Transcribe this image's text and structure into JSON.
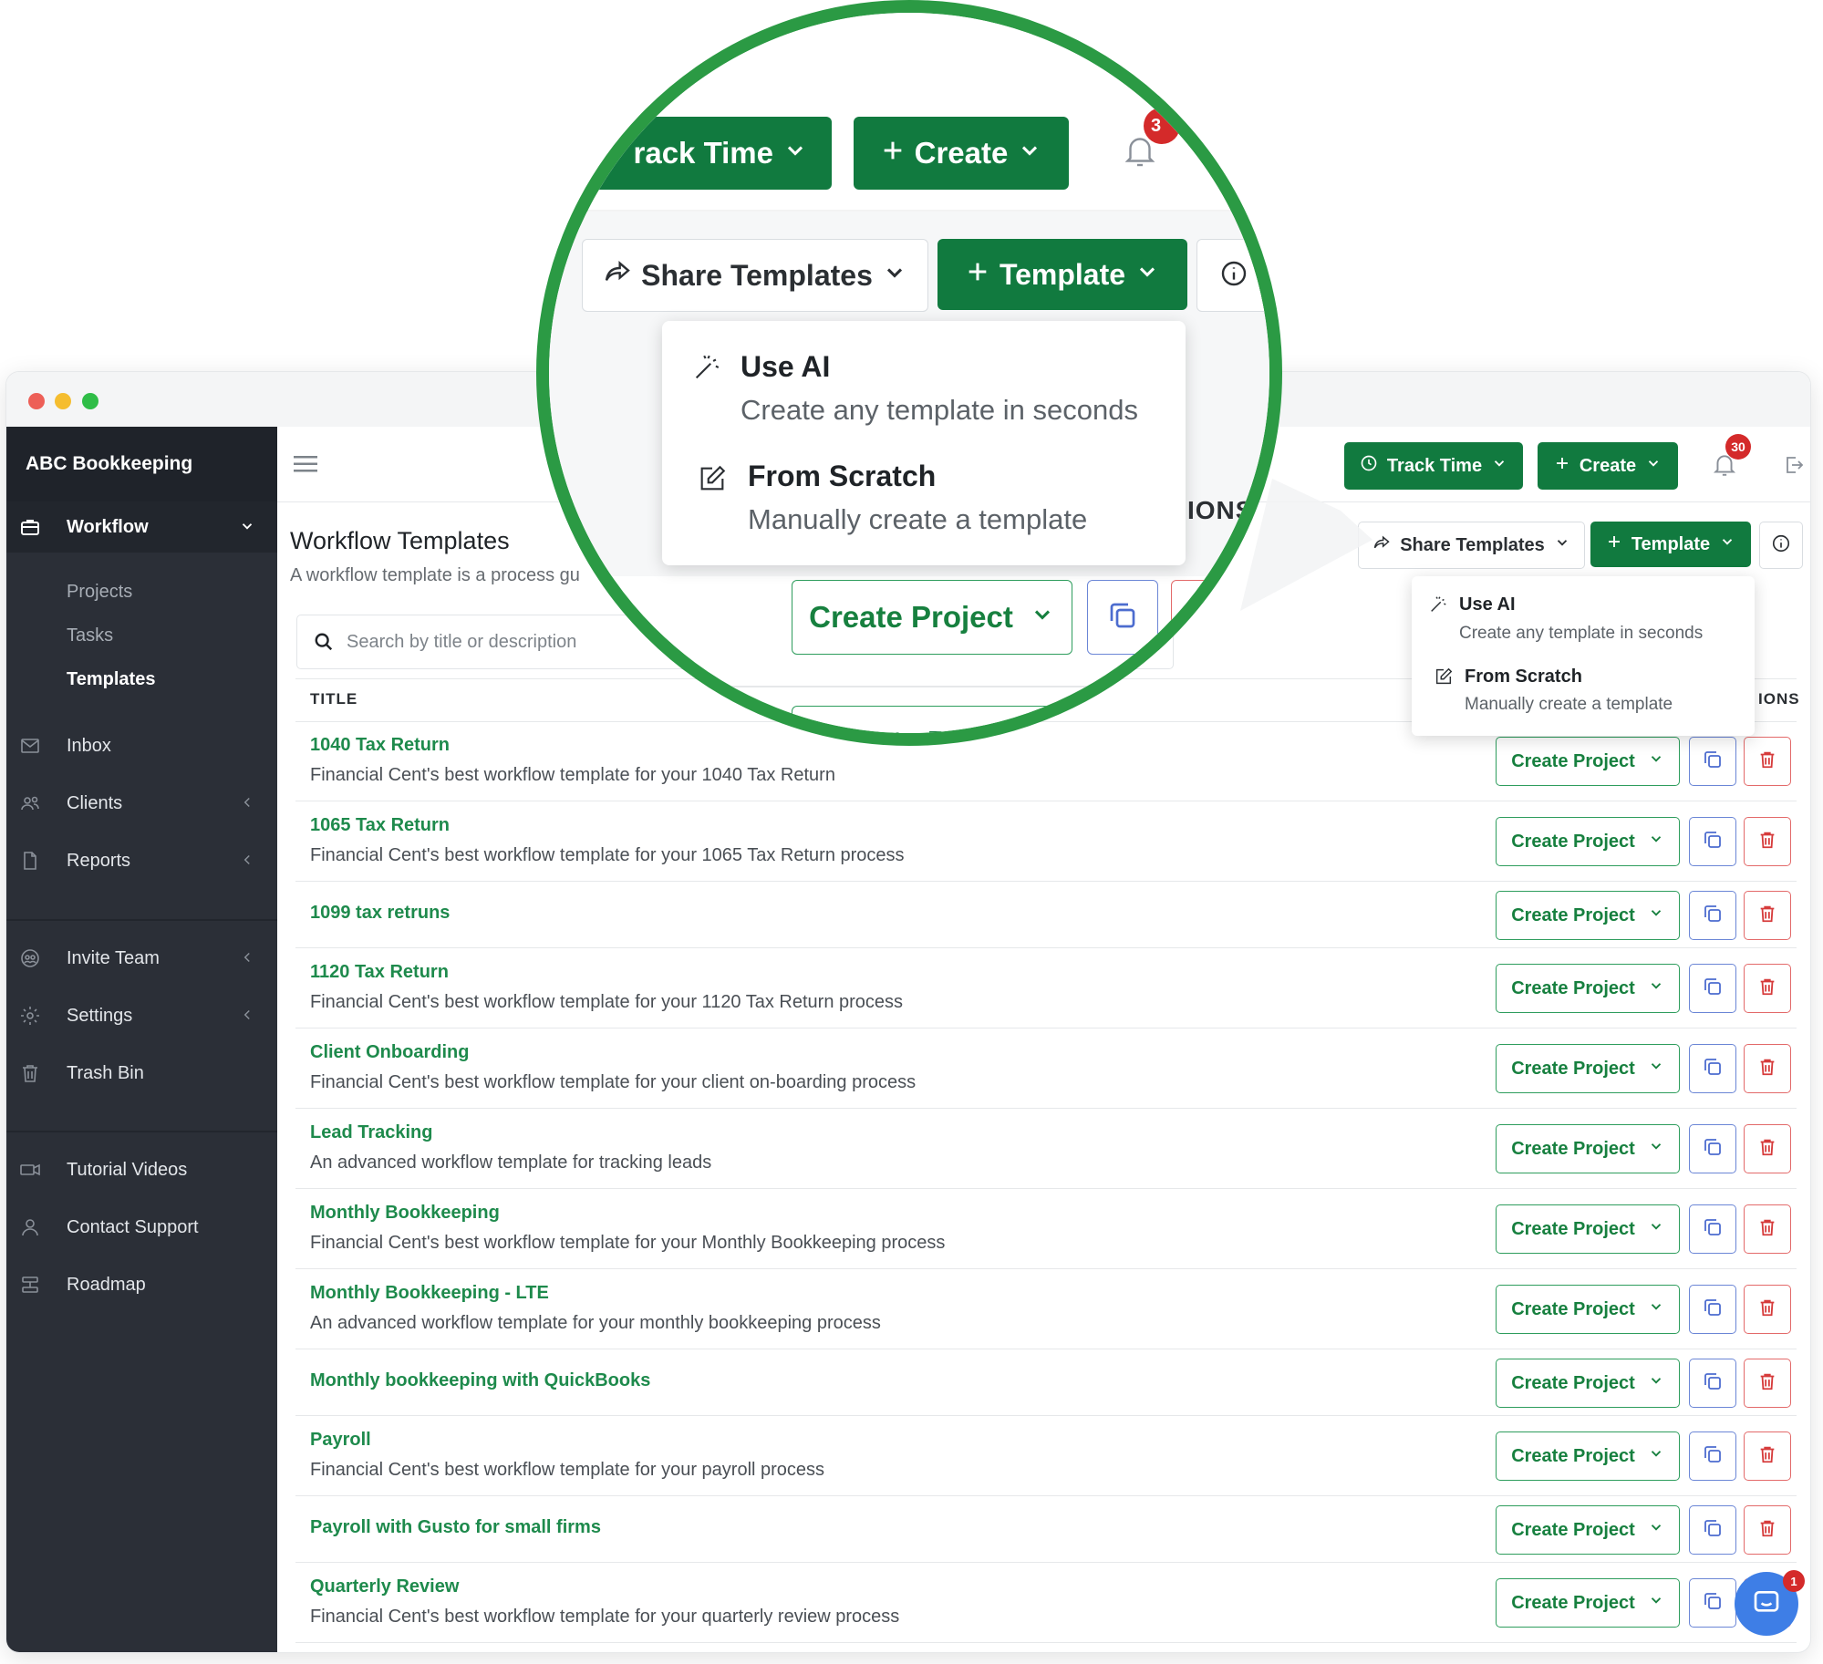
{
  "brand": "ABC Bookkeeping",
  "sidebar": {
    "workflow": "Workflow",
    "sub_items": [
      "Projects",
      "Tasks",
      "Templates"
    ],
    "inbox": "Inbox",
    "clients": "Clients",
    "reports": "Reports",
    "invite_team": "Invite Team",
    "settings": "Settings",
    "trash_bin": "Trash Bin",
    "tutorial_videos": "Tutorial Videos",
    "contact_support": "Contact Support",
    "roadmap": "Roadmap"
  },
  "topbar": {
    "track_time": "Track Time",
    "create": "Create",
    "notification_count": "30",
    "notification_count_partial": "3"
  },
  "toolbar": {
    "share_templates": "Share Templates",
    "template": "Template"
  },
  "dropdown": {
    "use_ai_title": "Use AI",
    "use_ai_desc": "Create any template in seconds",
    "scratch_title": "From Scratch",
    "scratch_desc": "Manually create a template"
  },
  "page": {
    "title": "Workflow Templates",
    "subtitle": "A workflow template is a process gu"
  },
  "search": {
    "placeholder": "Search by title or description",
    "value": ""
  },
  "table": {
    "col_title": "TITLE",
    "col_actions": "IONS",
    "create_project": "Create Project",
    "rows": [
      {
        "title": "1040 Tax Return",
        "desc": "Financial Cent's best workflow template for your 1040 Tax Return"
      },
      {
        "title": "1065 Tax Return",
        "desc": "Financial Cent's best workflow template for your 1065 Tax Return process"
      },
      {
        "title": "1099 tax retruns",
        "desc": ""
      },
      {
        "title": "1120 Tax Return",
        "desc": "Financial Cent's best workflow template for your 1120 Tax Return process"
      },
      {
        "title": "Client Onboarding",
        "desc": "Financial Cent's best workflow template for your client on-boarding process"
      },
      {
        "title": "Lead Tracking",
        "desc": "An advanced workflow template for tracking leads"
      },
      {
        "title": "Monthly Bookkeeping",
        "desc": "Financial Cent's best workflow template for your Monthly Bookkeeping process"
      },
      {
        "title": "Monthly Bookkeeping - LTE",
        "desc": "An advanced workflow template for your monthly bookkeeping process"
      },
      {
        "title": "Monthly bookkeeping with QuickBooks",
        "desc": ""
      },
      {
        "title": "Payroll",
        "desc": "Financial Cent's best workflow template for your payroll process"
      },
      {
        "title": "Payroll with Gusto for small firms",
        "desc": ""
      },
      {
        "title": "Quarterly Review",
        "desc": "Financial Cent's best workflow template for your quarterly review process"
      }
    ]
  },
  "magnifier": {
    "track_time_partial": "rack Time",
    "actions_partial": "IONS",
    "create_project_partial": "Create Proj"
  },
  "chat_badge": "1",
  "colors": {
    "primary_green": "#117a3f",
    "link_green": "#1e8a4c",
    "magnifier_ring": "#2b9a44",
    "sidebar_bg": "#2b2f37",
    "badge_red": "#d42a2a",
    "copy_blue": "#6b86d6",
    "delete_red": "#e36a6a",
    "chat_blue": "#3e7ee6"
  }
}
